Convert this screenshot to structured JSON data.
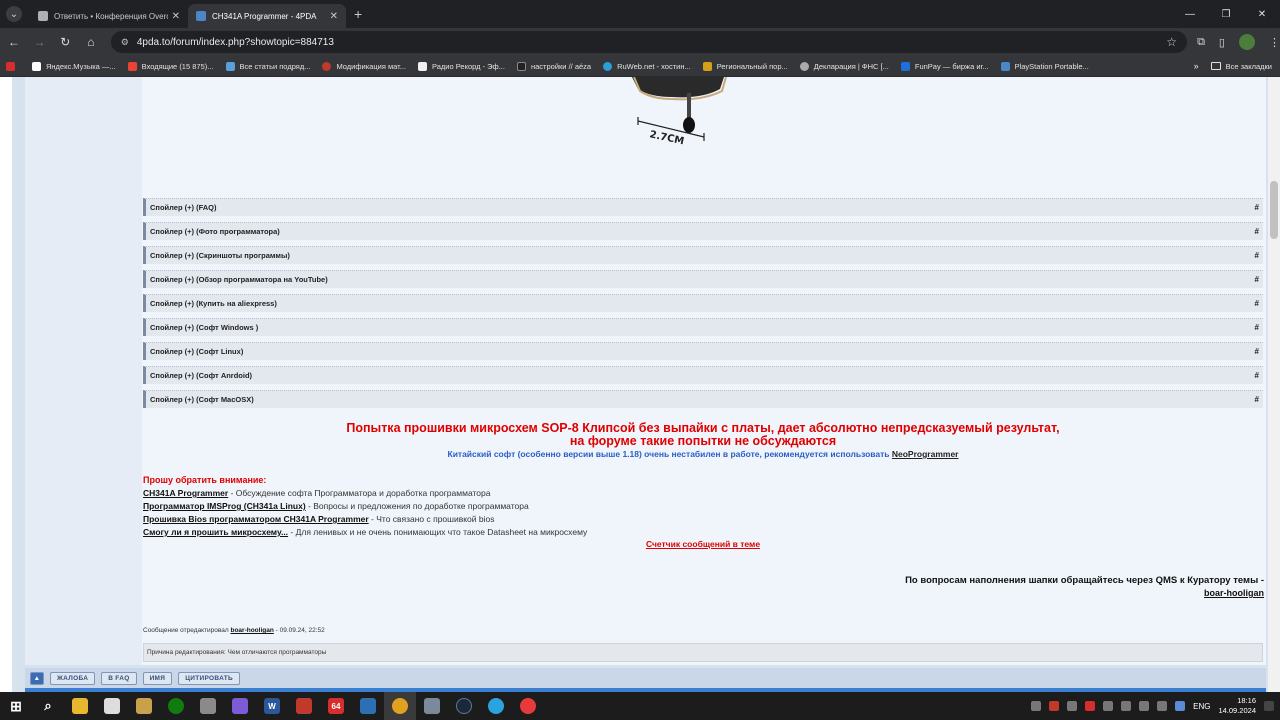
{
  "browser": {
    "tabs": [
      {
        "label": "Ответить • Конференция Overclockers.ru",
        "active": false,
        "favicon_color": "#b0b0b0"
      },
      {
        "label": "CH341A Programmer - 4PDA",
        "active": true,
        "favicon_color": "#4a86c8"
      }
    ],
    "url": "4pda.to/forum/index.php?showtopic=884713",
    "bookmarks": [
      {
        "label": "",
        "color": "#d62d2d"
      },
      {
        "label": "Яндекс.Музыка —...",
        "color": "#ffffff"
      },
      {
        "label": "Входящие (15 875)...",
        "color": "#ea4335"
      },
      {
        "label": "Все статьи подряд...",
        "color": "#5aa0d8"
      },
      {
        "label": "Модификация мат...",
        "color": "#c0392b"
      },
      {
        "label": "Радио Рекорд - Эф...",
        "color": "#f0f0f0"
      },
      {
        "label": "настройки // aéza",
        "color": "#222222"
      },
      {
        "label": "RuWeb.net - хостин...",
        "color": "#2a9fd6"
      },
      {
        "label": "Региональный пор...",
        "color": "#d4a017"
      },
      {
        "label": "Декларация | ФНС [...",
        "color": "#aaaaaa"
      },
      {
        "label": "FunPay — биржа иг...",
        "color": "#1e6fd9"
      },
      {
        "label": "PlayStation Portable...",
        "color": "#4a86c8"
      }
    ],
    "all_bookmarks": "Все закладки"
  },
  "post": {
    "photo_dimension": "2.7CM",
    "spoilers": [
      "Спойлер (+) (FAQ)",
      "Спойлер (+) (Фото программатора)",
      "Спойлер (+) (Скриншоты программы)",
      "Спойлер (+) (Обзор программатора на YouTube)",
      "Спойлер (+) (Купить на aliexpress)",
      "Спойлер (+) (Софт Windows )",
      "Спойлер (+) (Софт Linux)",
      "Спойлер (+) (Софт Anrdoid)",
      "Спойлер (+) (Софт MacOSX)"
    ],
    "spoiler_hash": "#",
    "warning_line1": "Попытка прошивки микросхем SOP-8 Клипсой без выпайки с платы, дает абсолютно непредсказуемый результат,",
    "warning_line2": "на форуме такие попытки не обсуждаются",
    "soft_note": "Китайский софт (особенно версии выше 1.18) очень нестабилен в работе, рекомендуется использовать",
    "soft_link": "NeoProgrammer",
    "attention": "Прошу обратить внимание:",
    "links": [
      {
        "link": "CH341A Programmer",
        "desc": " - Обсуждение софта Программатора и доработка программатора"
      },
      {
        "link": "Программатор IMSProg (CH341a Linux)",
        "desc": " - Вопросы и предложения по доработке программатора"
      },
      {
        "link": "Прошивка Bios программатором CH341A Programmer",
        "desc": " - Что связано с прошивкой bios"
      },
      {
        "link": "Смогу ли я прошить микросхему...",
        "desc": " - Для ленивых и не очень понимающих что такое Datasheet на микросхему"
      }
    ],
    "counter": "Счетчик сообщений в теме",
    "curator_text": "По вопросам наполнения шапки обращайтесь через QMS к Куратору темы -",
    "curator_link": "boar-hooligan",
    "edited_prefix": "Сообщение отредактировал",
    "edited_user": "boar-hooligan",
    "edited_date": " - 09.09.24, 22:52",
    "edit_reason": "Причина редактирования: Чем отличаются программаторы"
  },
  "actions": {
    "up": "▲",
    "report": "ЖАЛОБА",
    "faq": "В FAQ",
    "name": "ИМЯ",
    "quote": "ЦИТИРОВАТЬ"
  },
  "taskbar": {
    "apps": [
      {
        "name": "start-icon",
        "color": "#2f7fd8"
      },
      {
        "name": "search-icon",
        "color": "#1c1c1c"
      },
      {
        "name": "explorer-icon",
        "color": "#e8b730"
      },
      {
        "name": "notepad-icon",
        "color": "#dddddd"
      },
      {
        "name": "wand-icon",
        "color": "#c9a14a"
      },
      {
        "name": "xbox-icon",
        "color": "#107c10"
      },
      {
        "name": "photos-icon",
        "color": "#8a8a8a"
      },
      {
        "name": "gamepad-icon",
        "color": "#7b5cd6"
      },
      {
        "name": "word-icon",
        "color": "#2b579a"
      },
      {
        "name": "msi-icon",
        "color": "#c0392b"
      },
      {
        "name": "aida64-icon",
        "color": "#d62d2d"
      },
      {
        "name": "ups-icon",
        "color": "#2d6fb5"
      },
      {
        "name": "chrome-icon",
        "color": "#e0a020"
      },
      {
        "name": "tool-icon",
        "color": "#7a8a99"
      },
      {
        "name": "steam-icon",
        "color": "#1b2838"
      },
      {
        "name": "telegram-icon",
        "color": "#2aa3de"
      },
      {
        "name": "yandex-icon",
        "color": "#e83a3a"
      }
    ],
    "aida_label": "64",
    "lang": "ENG",
    "time": "18:16",
    "date": "14.09.2024"
  }
}
